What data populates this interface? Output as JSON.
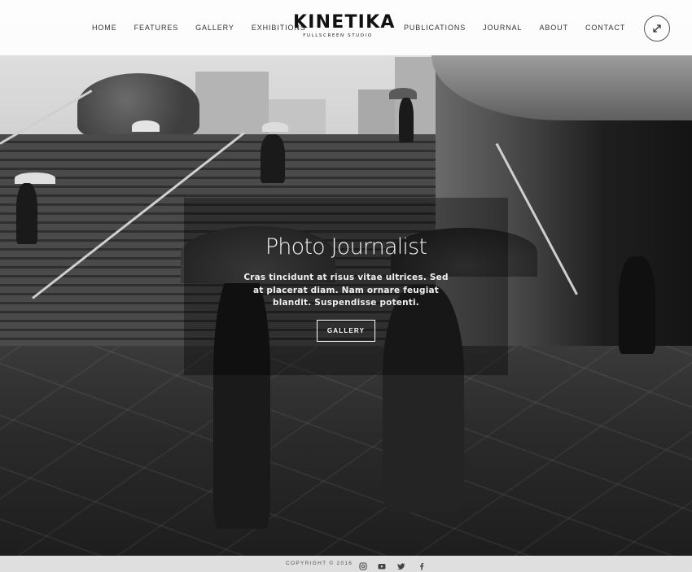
{
  "brand": {
    "title": "KINETIKA",
    "subtitle": "FULLSCREEN STUDIO"
  },
  "nav": {
    "left": [
      {
        "label": "HOME"
      },
      {
        "label": "FEATURES"
      },
      {
        "label": "GALLERY"
      },
      {
        "label": "EXHIBITIONS"
      }
    ],
    "right": [
      {
        "label": "PUBLICATIONS"
      },
      {
        "label": "JOURNAL"
      },
      {
        "label": "ABOUT"
      },
      {
        "label": "CONTACT"
      }
    ]
  },
  "header_actions": {
    "fullscreen_icon": "expand-arrows-icon"
  },
  "hero": {
    "title": "Photo Journalist",
    "text": "Cras tincidunt at risus vitae ultrices. Sed at placerat diam. Nam ornare feugiat blandit. Suspendisse potenti.",
    "button_label": "GALLERY"
  },
  "footer": {
    "copyright": "COPYRIGHT © 2016",
    "social": [
      {
        "icon": "instagram-icon"
      },
      {
        "icon": "youtube-icon"
      },
      {
        "icon": "twitter-icon"
      },
      {
        "icon": "facebook-icon"
      }
    ]
  },
  "colors": {
    "header_bg": "#ffffff",
    "text_dark": "#333333",
    "caption_bg": "#000000",
    "accent": "#ffffff"
  }
}
